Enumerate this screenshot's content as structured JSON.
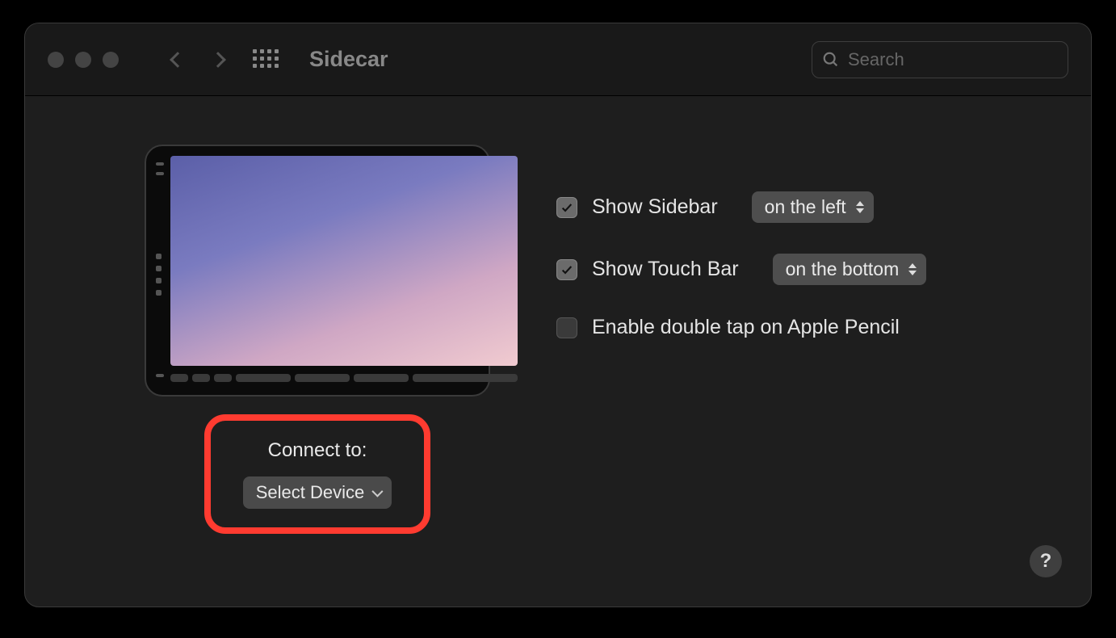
{
  "window": {
    "title": "Sidecar",
    "search_placeholder": "Search"
  },
  "connect": {
    "label": "Connect to:",
    "device_button": "Select Device"
  },
  "options": {
    "sidebar": {
      "label": "Show Sidebar",
      "checked": true,
      "value": "on the left"
    },
    "touchbar": {
      "label": "Show Touch Bar",
      "checked": true,
      "value": "on the bottom"
    },
    "pencil": {
      "label": "Enable double tap on Apple Pencil",
      "checked": false
    }
  },
  "help": {
    "label": "?"
  }
}
